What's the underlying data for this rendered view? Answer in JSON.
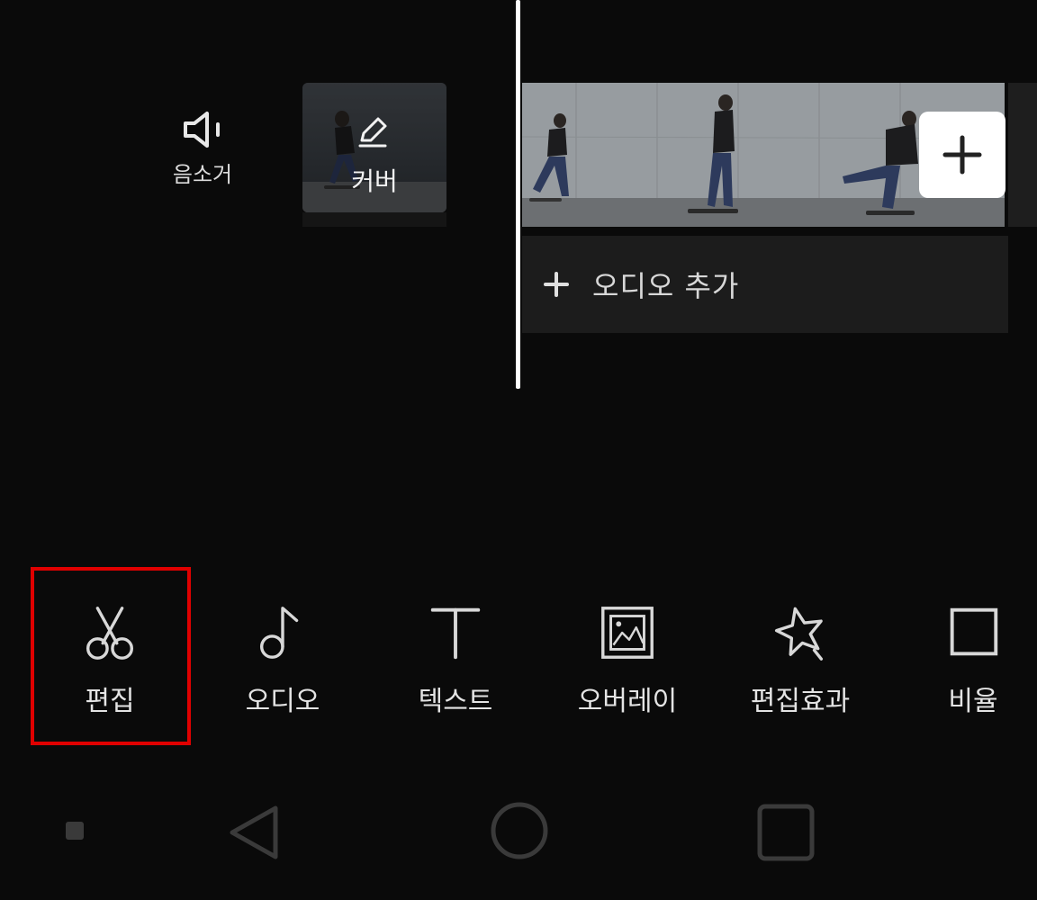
{
  "timeline": {
    "mute_label": "음소거",
    "cover_label": "커버",
    "add_audio_label": "오디오 추가"
  },
  "toolbar": {
    "items": [
      {
        "label": "편집",
        "icon": "scissors-icon",
        "selected": true
      },
      {
        "label": "오디오",
        "icon": "music-note-icon"
      },
      {
        "label": "텍스트",
        "icon": "text-icon"
      },
      {
        "label": "오버레이",
        "icon": "overlay-image-icon"
      },
      {
        "label": "편집효과",
        "icon": "sparkle-effect-icon"
      },
      {
        "label": "비율",
        "icon": "aspect-ratio-icon"
      }
    ]
  },
  "colors": {
    "background": "#0a0a0a",
    "highlight": "#e00000",
    "playhead": "#ffffff"
  }
}
